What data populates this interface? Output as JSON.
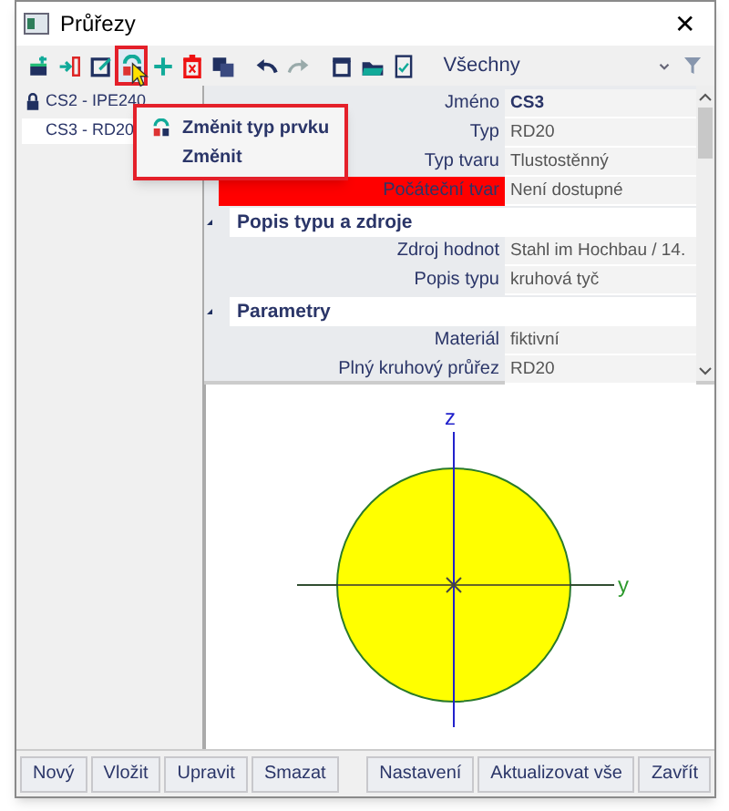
{
  "window": {
    "title": "Průřezy",
    "close": "✕"
  },
  "toolbar": {
    "buttons": [
      {
        "kind": "add",
        "highlighted": false
      },
      {
        "kind": "insert",
        "highlighted": false
      },
      {
        "kind": "edit",
        "highlighted": false
      },
      {
        "kind": "change",
        "highlighted": true
      },
      {
        "kind": "plus",
        "highlighted": false
      },
      {
        "kind": "delete",
        "highlighted": false
      },
      {
        "kind": "copy",
        "highlighted": false
      },
      {
        "kind": "undo",
        "highlighted": false
      },
      {
        "kind": "redo",
        "highlighted": false
      },
      {
        "kind": "library",
        "highlighted": false
      },
      {
        "kind": "open",
        "highlighted": false
      },
      {
        "kind": "check",
        "highlighted": false
      }
    ],
    "filter": {
      "value": "Všechny"
    }
  },
  "tree": {
    "items": [
      {
        "label": "CS2 - IPE240",
        "locked": true,
        "selected": false
      },
      {
        "label": "CS3 - RD20",
        "locked": false,
        "selected": true
      }
    ]
  },
  "popup_menu": {
    "items": [
      {
        "label": "Změnit typ prvku",
        "icon": true
      },
      {
        "label": "Změnit",
        "icon": false
      }
    ]
  },
  "properties": [
    {
      "kind": "row",
      "label": "Jméno",
      "value": "CS3",
      "bold": true,
      "highlighted": false
    },
    {
      "kind": "row",
      "label": "Typ",
      "value": "RD20",
      "bold": false,
      "highlighted": false
    },
    {
      "kind": "row",
      "label": "Typ tvaru",
      "value": "Tlustostěnný",
      "bold": false,
      "highlighted": false
    },
    {
      "kind": "row",
      "label": "Počáteční tvar",
      "value": "Není dostupné",
      "bold": false,
      "highlighted": true
    },
    {
      "kind": "section",
      "label": "Popis typu a zdroje"
    },
    {
      "kind": "row",
      "label": "Zdroj hodnot",
      "value": "Stahl im Hochbau / 14.",
      "bold": false,
      "highlighted": false
    },
    {
      "kind": "row",
      "label": "Popis typu",
      "value": "kruhová tyč",
      "bold": false,
      "highlighted": false
    },
    {
      "kind": "section",
      "label": "Parametry"
    },
    {
      "kind": "row",
      "label": "Materiál",
      "value": "fiktivní",
      "bold": false,
      "highlighted": false
    },
    {
      "kind": "row",
      "label": "Plný kruhový průřez",
      "value": "RD20",
      "bold": false,
      "highlighted": false
    }
  ],
  "preview": {
    "axis_z": "z",
    "axis_y": "y"
  },
  "buttons_left": [
    "Nový",
    "Vložit",
    "Upravit",
    "Smazat"
  ],
  "buttons_right": [
    "Nastavení",
    "Aktualizovat vše",
    "Zavřít"
  ]
}
